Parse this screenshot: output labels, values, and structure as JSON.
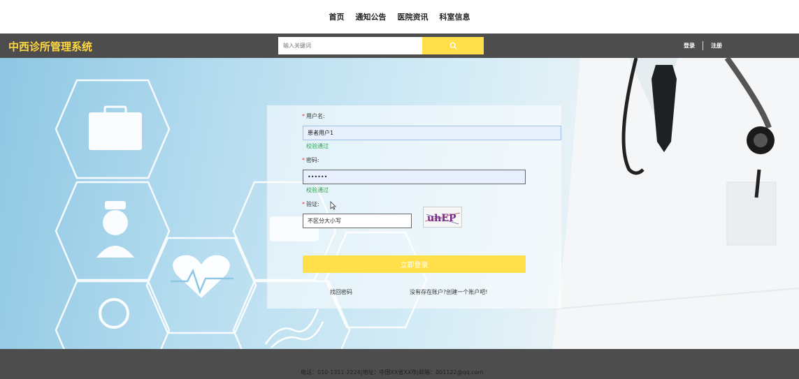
{
  "topnav": {
    "items": [
      "首页",
      "通知公告",
      "医院资讯",
      "科室信息"
    ]
  },
  "header": {
    "brand": "中西诊所管理系统",
    "search_placeholder": "输入关键词",
    "login": "登录",
    "register": "注册"
  },
  "form": {
    "username_label": "用户名:",
    "username_value": "患者用户1",
    "username_ok": "校验通过",
    "password_label": "密码:",
    "password_value": "••••••",
    "password_ok": "校验通过",
    "captcha_label": "验证:",
    "captcha_value": "不区分大小写",
    "captcha_text": "uhEP",
    "submit": "立即登录",
    "forgot": "找回密码",
    "create": "没有存在账户?创建一个账户吧!"
  },
  "footer": {
    "text": "电话：010-1311-2224|地址：中国XX省XX市|邮箱：001122@qq.com"
  },
  "colors": {
    "accent": "#ffe04a",
    "brand": "#ffd740",
    "bar": "#4d4d4d",
    "success": "#2aa54a"
  }
}
